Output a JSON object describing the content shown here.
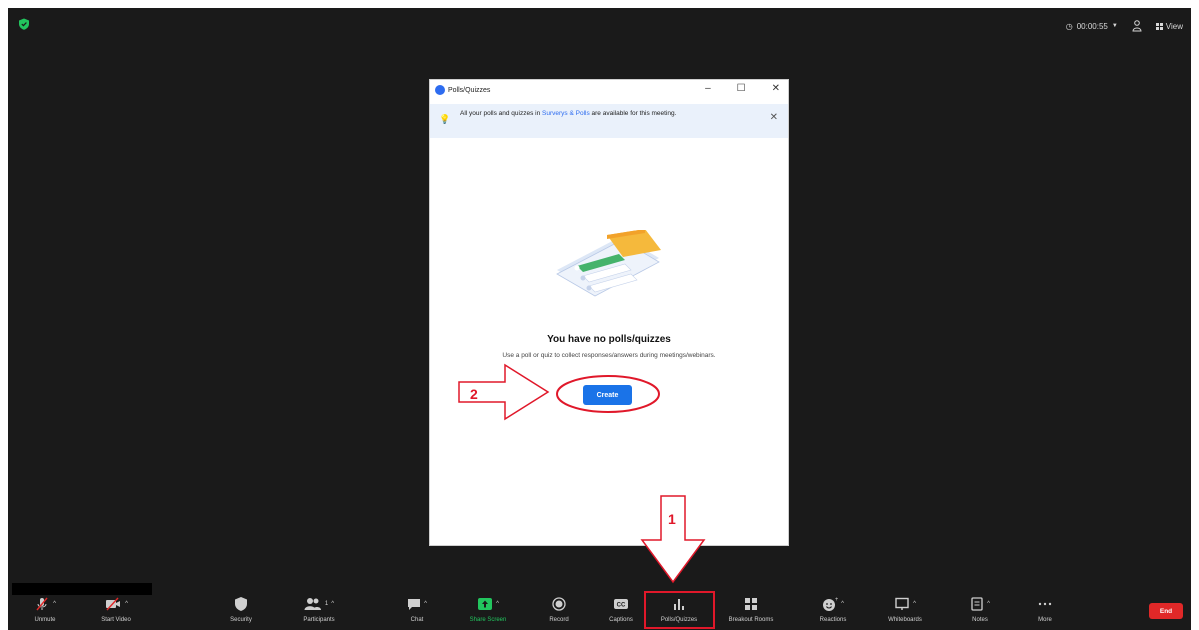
{
  "colors": {
    "accent": "#1a73e8",
    "annotation": "#e0182a",
    "end": "#e02828",
    "share": "#22c55e"
  },
  "header": {
    "timer": "00:00:55",
    "view_label": "View"
  },
  "dialog": {
    "title": "Polls/Quizzes",
    "info_prefix": "All your polls and quizzes in",
    "info_link": "Surverys & Polls",
    "info_suffix": "are available for this meeting.",
    "empty_title": "You have no polls/quizzes",
    "empty_subtitle": "Use a poll or quiz to collect responses/answers during meetings/webinars.",
    "create_label": "Create"
  },
  "annotations": {
    "step1": "1",
    "step2": "2"
  },
  "toolbar": {
    "items": [
      {
        "label": "Unmute",
        "icon": "mic-muted-icon"
      },
      {
        "label": "Start Video",
        "icon": "video-off-icon"
      },
      {
        "label": "Security",
        "icon": "shield-icon"
      },
      {
        "label": "Participants",
        "icon": "participants-icon",
        "count": "1"
      },
      {
        "label": "Chat",
        "icon": "chat-icon"
      },
      {
        "label": "Share Screen",
        "icon": "share-screen-icon"
      },
      {
        "label": "Record",
        "icon": "record-icon"
      },
      {
        "label": "Captions",
        "icon": "captions-icon"
      },
      {
        "label": "Polls/Quizzes",
        "icon": "polls-icon"
      },
      {
        "label": "Breakout Rooms",
        "icon": "breakout-icon"
      },
      {
        "label": "Reactions",
        "icon": "reactions-icon"
      },
      {
        "label": "Whiteboards",
        "icon": "whiteboard-icon"
      },
      {
        "label": "Notes",
        "icon": "notes-icon"
      },
      {
        "label": "More",
        "icon": "more-icon"
      }
    ],
    "end_label": "End"
  }
}
